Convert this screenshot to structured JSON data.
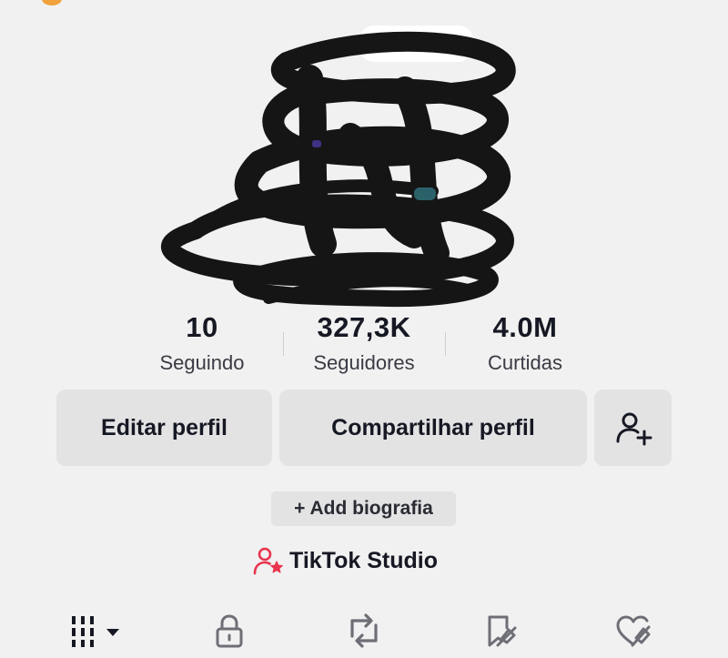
{
  "profile": {
    "stats": [
      {
        "value": "10",
        "label": "Seguindo"
      },
      {
        "value": "327,3K",
        "label": "Seguidores"
      },
      {
        "value": "4.0M",
        "label": "Curtidas"
      }
    ],
    "actions": {
      "edit_label": "Editar perfil",
      "share_label": "Compartilhar perfil",
      "add_friend_icon": "person-plus-icon"
    },
    "bio_button_label": "+ Add biografia",
    "studio": {
      "icon": "person-star-icon",
      "label": "TikTok Studio"
    }
  },
  "tabs": [
    {
      "icon": "grid-icon",
      "active": true
    },
    {
      "icon": "lock-icon",
      "active": false
    },
    {
      "icon": "repost-icon",
      "active": false
    },
    {
      "icon": "bookmark-icon",
      "active": false
    },
    {
      "icon": "liked-heart-icon",
      "active": false
    }
  ],
  "colors": {
    "background": "#f1f1f1",
    "button": "#e3e3e4",
    "text": "#161823",
    "studio_accent": "#e8344e"
  }
}
